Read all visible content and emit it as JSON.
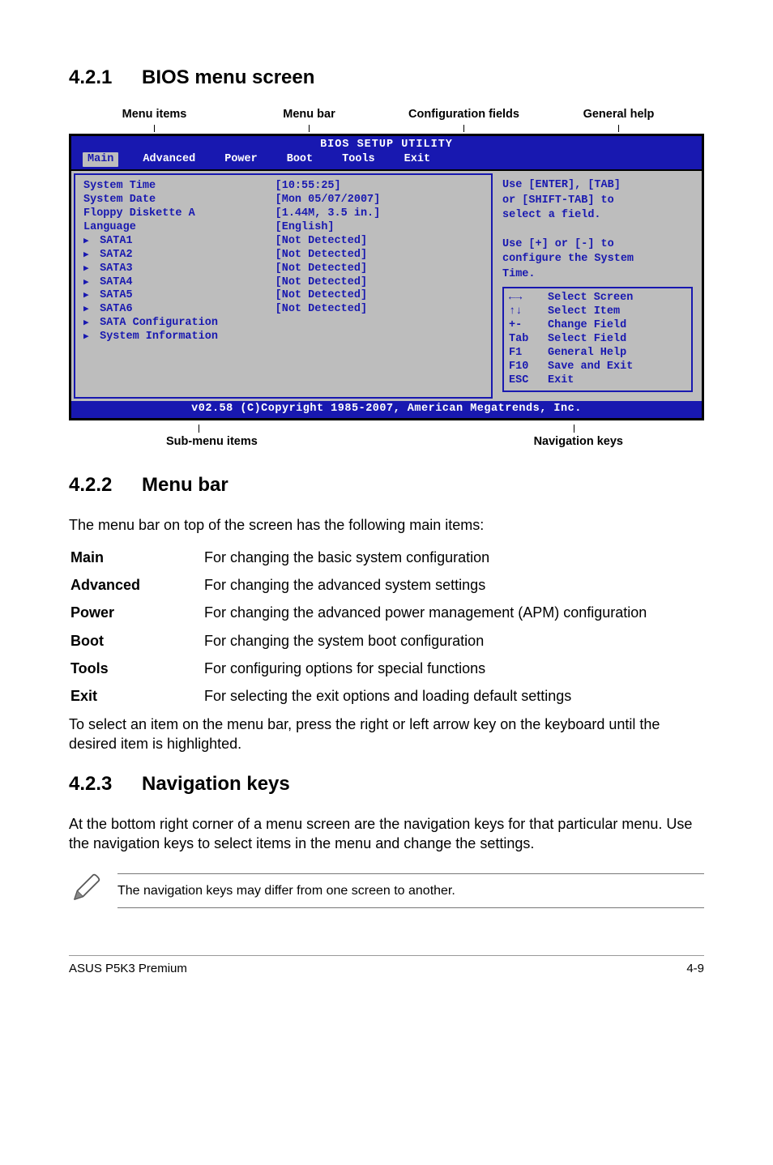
{
  "headings": {
    "s1_num": "4.2.1",
    "s1_title": "BIOS menu screen",
    "s2_num": "4.2.2",
    "s2_title": "Menu bar",
    "s3_num": "4.2.3",
    "s3_title": "Navigation keys"
  },
  "annotations": {
    "top": [
      "Menu items",
      "Menu bar",
      "Configuration fields",
      "General help"
    ],
    "bottom_left": "Sub-menu items",
    "bottom_right": "Navigation keys"
  },
  "bios": {
    "title": "BIOS SETUP UTILITY",
    "tabs": [
      "Main",
      "Advanced",
      "Power",
      "Boot",
      "Tools",
      "Exit"
    ],
    "fields": [
      {
        "label": "System Time",
        "value": "[10:55:25]",
        "sub": false
      },
      {
        "label": "System Date",
        "value": "[Mon 05/07/2007]",
        "sub": false
      },
      {
        "label": "Floppy Diskette A",
        "value": "[1.44M, 3.5 in.]",
        "sub": false
      },
      {
        "label": "Language",
        "value": "[English]",
        "sub": false
      },
      {
        "label": "",
        "value": "",
        "sub": false
      },
      {
        "label": "SATA1",
        "value": "[Not Detected]",
        "sub": true
      },
      {
        "label": "SATA2",
        "value": "[Not Detected]",
        "sub": true
      },
      {
        "label": "SATA3",
        "value": "[Not Detected]",
        "sub": true
      },
      {
        "label": "SATA4",
        "value": "[Not Detected]",
        "sub": true
      },
      {
        "label": "SATA5",
        "value": "[Not Detected]",
        "sub": true
      },
      {
        "label": "SATA6",
        "value": "[Not Detected]",
        "sub": true
      },
      {
        "label": "",
        "value": "",
        "sub": false
      },
      {
        "label": "SATA Configuration",
        "value": "",
        "sub": true
      },
      {
        "label": "System Information",
        "value": "",
        "sub": true
      }
    ],
    "help_top": "Use [ENTER], [TAB]\nor [SHIFT-TAB] to\nselect a field.\n\nUse [+] or [-] to\nconfigure the System\nTime.",
    "nav": [
      {
        "key": "←→",
        "desc": "Select Screen"
      },
      {
        "key": "↑↓",
        "desc": "Select Item"
      },
      {
        "key": "+-",
        "desc": "Change Field"
      },
      {
        "key": "Tab",
        "desc": "Select Field"
      },
      {
        "key": "F1",
        "desc": "General Help"
      },
      {
        "key": "F10",
        "desc": "Save and Exit"
      },
      {
        "key": "ESC",
        "desc": "Exit"
      }
    ],
    "footer": "v02.58 (C)Copyright 1985-2007, American Megatrends, Inc."
  },
  "menubar_intro": "The menu bar on top of the screen has the following main items:",
  "definitions": [
    {
      "term": "Main",
      "desc": "For changing the basic system configuration"
    },
    {
      "term": "Advanced",
      "desc": "For changing the advanced system settings"
    },
    {
      "term": "Power",
      "desc": "For changing the advanced power management (APM) configuration"
    },
    {
      "term": "Boot",
      "desc": "For changing the system boot configuration"
    },
    {
      "term": "Tools",
      "desc": "For configuring options for special functions"
    },
    {
      "term": "Exit",
      "desc": "For selecting the exit options and loading default settings"
    }
  ],
  "menubar_outro": "To select an item on the menu bar, press the right or left arrow key on the keyboard until the desired item is highlighted.",
  "navkeys_para": "At the bottom right corner of a menu screen are the navigation keys for that particular menu. Use the navigation keys to select items in the menu and change the settings.",
  "note": "The navigation keys may differ from one screen to another.",
  "footer": {
    "left": "ASUS P5K3 Premium",
    "right": "4-9"
  }
}
